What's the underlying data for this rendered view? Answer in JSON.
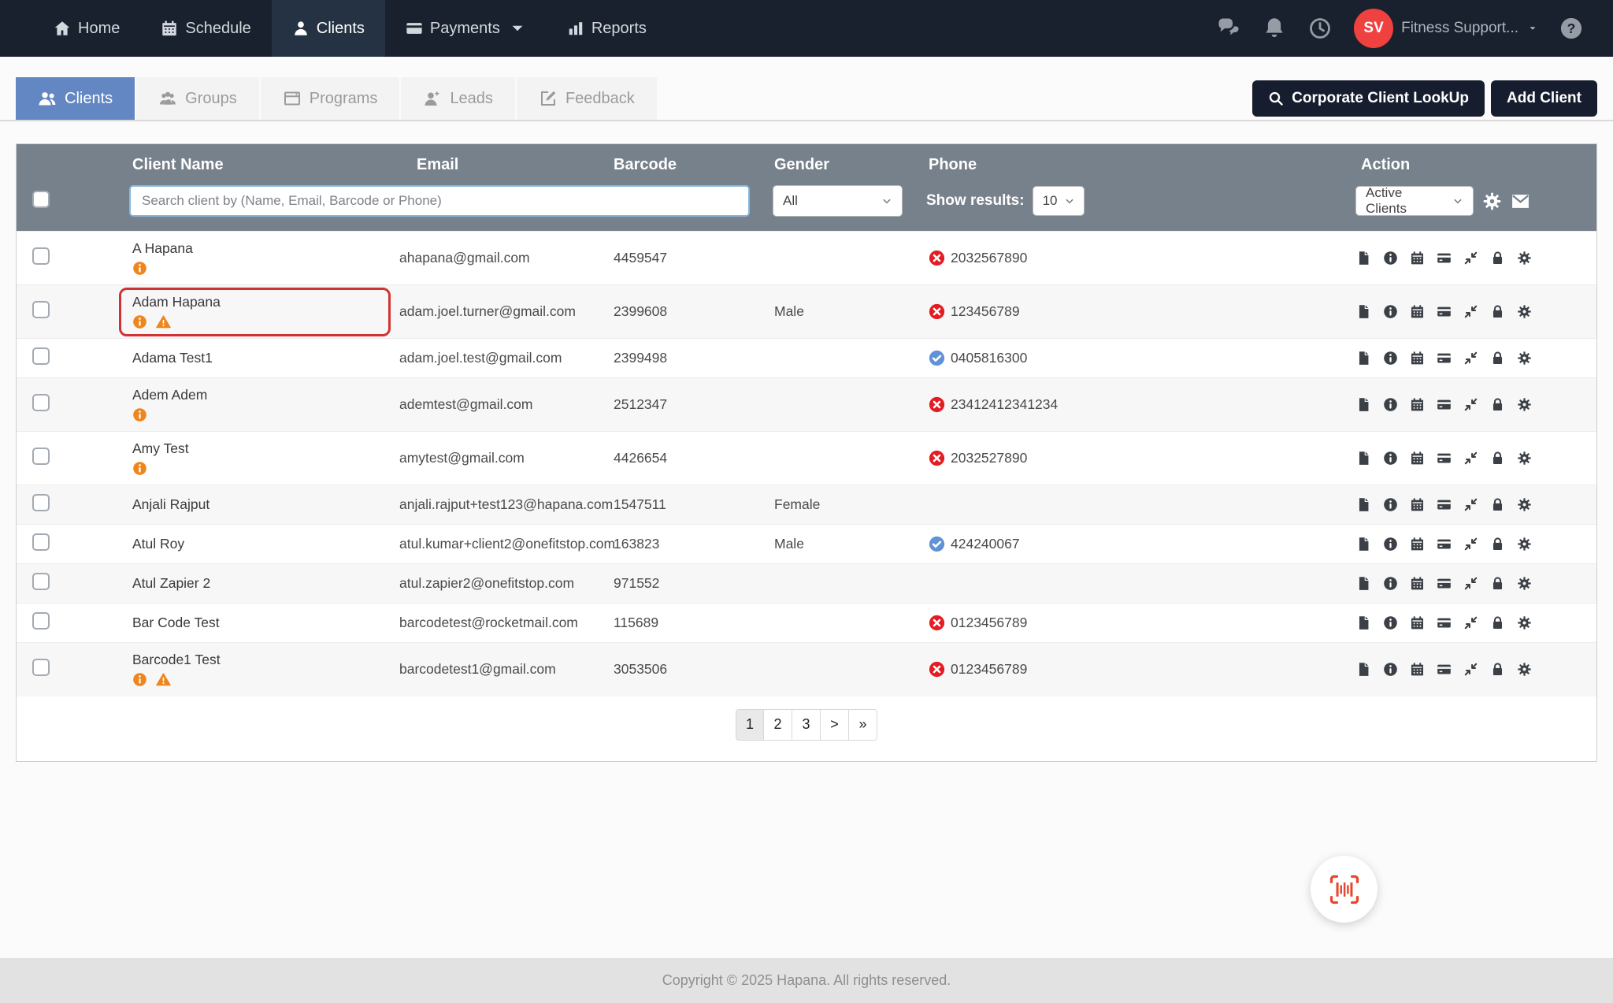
{
  "navbar": {
    "items": [
      {
        "label": "Home"
      },
      {
        "label": "Schedule"
      },
      {
        "label": "Clients",
        "active": true
      },
      {
        "label": "Payments",
        "has_caret": true
      },
      {
        "label": "Reports"
      }
    ],
    "avatar_initials": "SV",
    "account_name": "Fitness Support...",
    "right_icons": [
      "chat-icon",
      "bell-icon",
      "clock-icon",
      "help-icon"
    ]
  },
  "tabs": [
    {
      "label": "Clients",
      "active": true
    },
    {
      "label": "Groups"
    },
    {
      "label": "Programs"
    },
    {
      "label": "Leads"
    },
    {
      "label": "Feedback"
    }
  ],
  "header_actions": {
    "corporate_lookup": "Corporate Client LookUp",
    "add_client": "Add Client"
  },
  "table": {
    "columns": [
      "Client Name",
      "Email",
      "Barcode",
      "Gender",
      "Phone",
      "Action"
    ],
    "filters": {
      "search_placeholder": "Search client by (Name, Email, Barcode or Phone)",
      "gender_value": "All",
      "show_results_label": "Show results:",
      "show_results_value": "10",
      "client_status_value": "Active Clients"
    },
    "action_icons": [
      "notes",
      "info",
      "calendar",
      "payment",
      "merge",
      "lock",
      "settings"
    ],
    "rows": [
      {
        "name": "A Hapana",
        "info": true,
        "warning": false,
        "highlighted": false,
        "email": "ahapana@gmail.com",
        "barcode": "4459547",
        "gender": "",
        "phone": {
          "valid": false,
          "number": "2032567890"
        }
      },
      {
        "name": "Adam Hapana",
        "info": true,
        "warning": true,
        "highlighted": true,
        "email": "adam.joel.turner@gmail.com",
        "barcode": "2399608",
        "gender": "Male",
        "phone": {
          "valid": false,
          "number": "123456789"
        }
      },
      {
        "name": "Adama Test1",
        "info": false,
        "warning": false,
        "highlighted": false,
        "email": "adam.joel.test@gmail.com",
        "barcode": "2399498",
        "gender": "",
        "phone": {
          "valid": true,
          "number": "0405816300"
        }
      },
      {
        "name": "Adem Adem",
        "info": true,
        "warning": false,
        "highlighted": false,
        "email": "ademtest@gmail.com",
        "barcode": "2512347",
        "gender": "",
        "phone": {
          "valid": false,
          "number": "23412412341234"
        }
      },
      {
        "name": "Amy Test",
        "info": true,
        "warning": false,
        "highlighted": false,
        "email": "amytest@gmail.com",
        "barcode": "4426654",
        "gender": "",
        "phone": {
          "valid": false,
          "number": "2032527890"
        }
      },
      {
        "name": "Anjali Rajput",
        "info": false,
        "warning": false,
        "highlighted": false,
        "email": "anjali.rajput+test123@hapana.com",
        "barcode": "1547511",
        "gender": "Female",
        "phone": null
      },
      {
        "name": "Atul Roy",
        "info": false,
        "warning": false,
        "highlighted": false,
        "email": "atul.kumar+client2@onefitstop.com",
        "barcode": "163823",
        "gender": "Male",
        "phone": {
          "valid": true,
          "number": "424240067"
        }
      },
      {
        "name": "Atul Zapier 2",
        "info": false,
        "warning": false,
        "highlighted": false,
        "email": "atul.zapier2@onefitstop.com",
        "barcode": "971552",
        "gender": "",
        "phone": null
      },
      {
        "name": "Bar Code Test",
        "info": false,
        "warning": false,
        "highlighted": false,
        "email": "barcodetest@rocketmail.com",
        "barcode": "115689",
        "gender": "",
        "phone": {
          "valid": false,
          "number": "0123456789"
        }
      },
      {
        "name": "Barcode1 Test",
        "info": true,
        "warning": true,
        "highlighted": false,
        "email": "barcodetest1@gmail.com",
        "barcode": "3053506",
        "gender": "",
        "phone": {
          "valid": false,
          "number": "0123456789"
        }
      }
    ]
  },
  "pagination": {
    "items": [
      "1",
      "2",
      "3",
      ">",
      "»"
    ],
    "active": "1"
  },
  "footer": {
    "copyright": "Copyright © 2025 Hapana. All rights reserved."
  },
  "colors": {
    "navbar": "#1a212e",
    "navbar_active": "#243243",
    "accent_blue": "#6387c3",
    "header_gray": "#76818c",
    "alert_orange": "#ef861d",
    "invalid_red": "#e41c23",
    "valid_blue": "#6092d8",
    "avatar_red": "#f04141",
    "highlight_red": "#cf3434",
    "barcode_red": "#e8472f",
    "dark_button": "#161d2e"
  }
}
